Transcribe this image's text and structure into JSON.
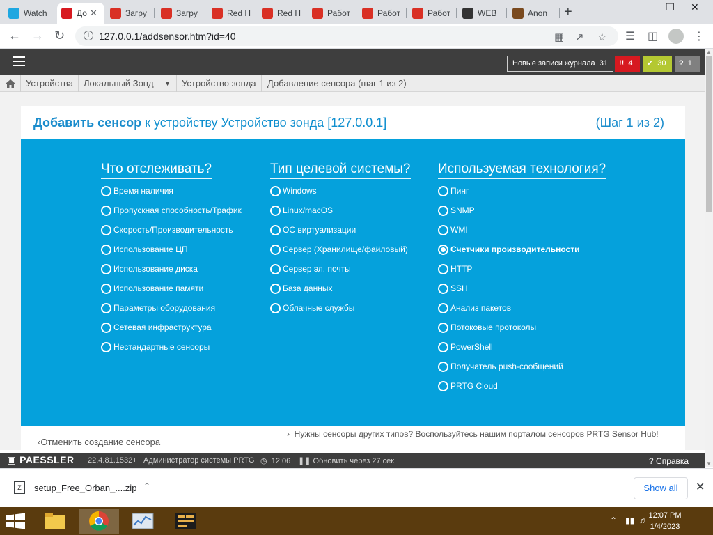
{
  "browser": {
    "tabs": [
      {
        "title": "Watch",
        "fav_color": "#1ea7e1",
        "active": false
      },
      {
        "title": "До",
        "fav_color": "#d71920",
        "active": true
      },
      {
        "title": "Загру",
        "fav_color": "#d93025",
        "active": false
      },
      {
        "title": "Загру",
        "fav_color": "#d93025",
        "active": false
      },
      {
        "title": "Red H",
        "fav_color": "#d93025",
        "active": false
      },
      {
        "title": "Red H",
        "fav_color": "#d93025",
        "active": false
      },
      {
        "title": "Работ",
        "fav_color": "#d93025",
        "active": false
      },
      {
        "title": "Работ",
        "fav_color": "#d93025",
        "active": false
      },
      {
        "title": "Работ",
        "fav_color": "#d93025",
        "active": false
      },
      {
        "title": "WEB",
        "fav_color": "#333333",
        "active": false
      },
      {
        "title": "Anon",
        "fav_color": "#7a4a1f",
        "active": false
      }
    ],
    "url": "127.0.0.1/addsensor.htm?id=40"
  },
  "header": {
    "log_label": "Новые записи журнала",
    "log_count": "31",
    "alarm_count": "4",
    "ok_count": "30",
    "unknown_count": "1",
    "colors": {
      "alarm": "#d71920",
      "ok": "#b4c832",
      "unknown": "#808080"
    }
  },
  "breadcrumb": {
    "items": [
      "Устройства",
      "Локальный Зонд",
      "Устройство зонда",
      "Добавление сенсора (шаг 1 из 2)"
    ]
  },
  "page": {
    "title_bold": "Добавить сенсор",
    "title_rest": "к устройству",
    "device_name": "Устройство зонда [127.0.0.1]",
    "step": "(Шаг 1 из 2)",
    "accent": "#05a1dc"
  },
  "columns": [
    {
      "heading": "Что отслеживать?",
      "options": [
        "Время наличия",
        "Пропускная способность/Трафик",
        "Скорость/Производительность",
        "Использование ЦП",
        "Использование диска",
        "Использование памяти",
        "Параметры оборудования",
        "Сетевая инфраструктура",
        "Нестандартные сенсоры"
      ]
    },
    {
      "heading": "Тип целевой системы?",
      "options": [
        "Windows",
        "Linux/macOS",
        "ОС виртуализации",
        "Сервер (Хранилище/файловый)",
        "Сервер эл. почты",
        "База данных",
        "Облачные службы"
      ]
    },
    {
      "heading": "Используемая технология?",
      "options": [
        "Пинг",
        "SNMP",
        "WMI",
        "Счетчики производительности",
        "HTTP",
        "SSH",
        "Анализ пакетов",
        "Потоковые протоколы",
        "PowerShell",
        "Получатель push-сообщений",
        "PRTG Cloud"
      ],
      "selected_index": 3
    }
  ],
  "links": {
    "hub": "Нужны сенсоры других типов? Воспользуйтесь нашим порталом сенсоров PRTG Sensor Hub!",
    "cancel": "Отменить создание сенсора"
  },
  "footer": {
    "logo": "PAESSLER",
    "version": "22.4.81.1532+",
    "user": "Администратор системы PRTG",
    "time": "12:06",
    "refresh": "Обновить через 27 сек",
    "help": "Справка"
  },
  "downloads": {
    "file": "setup_Free_Orban_....zip",
    "show_all": "Show all"
  },
  "taskbar": {
    "time": "12:07 PM",
    "date": "1/4/2023"
  }
}
